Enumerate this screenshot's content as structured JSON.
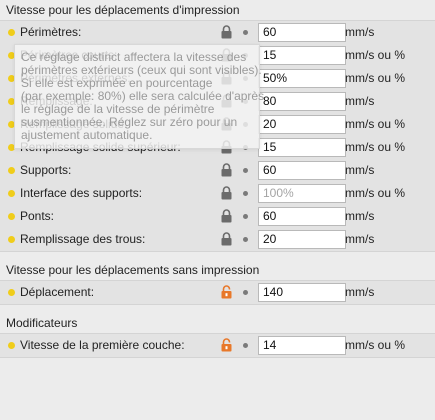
{
  "sections": [
    {
      "title": "Vitesse pour les déplacements d'impression",
      "rows": [
        {
          "label": "Périmètres:",
          "value": "60",
          "unit": "mm/s",
          "lock_color": "#6b6b6b",
          "placeholder": false
        },
        {
          "label": "Périmètres courts:",
          "value": "15",
          "unit": "mm/s ou %",
          "lock_color": "#6b6b6b",
          "placeholder": false
        },
        {
          "label": "Périmètres externes:",
          "value": "50%",
          "unit": "mm/s ou %",
          "lock_color": "#6b6b6b",
          "placeholder": false
        },
        {
          "label": "Remplissage:",
          "value": "80",
          "unit": "mm/s",
          "lock_color": "#6b6b6b",
          "placeholder": false
        },
        {
          "label": "Remplissage solide:",
          "value": "20",
          "unit": "mm/s ou %",
          "lock_color": "#6b6b6b",
          "placeholder": false
        },
        {
          "label": "Remplissage solide supérieur:",
          "value": "15",
          "unit": "mm/s ou %",
          "lock_color": "#6b6b6b",
          "placeholder": false
        },
        {
          "label": "Supports:",
          "value": "60",
          "unit": "mm/s",
          "lock_color": "#6b6b6b",
          "placeholder": false
        },
        {
          "label": "Interface des supports:",
          "value": "100%",
          "unit": "mm/s ou %",
          "lock_color": "#6b6b6b",
          "placeholder": true
        },
        {
          "label": "Ponts:",
          "value": "60",
          "unit": "mm/s",
          "lock_color": "#6b6b6b",
          "placeholder": false
        },
        {
          "label": "Remplissage des trous:",
          "value": "20",
          "unit": "mm/s",
          "lock_color": "#6b6b6b",
          "placeholder": false
        }
      ]
    },
    {
      "title": "Vitesse pour les déplacements sans impression",
      "rows": [
        {
          "label": "Déplacement:",
          "value": "140",
          "unit": "mm/s",
          "lock_color": "#e8782a",
          "placeholder": false
        }
      ]
    },
    {
      "title": "Modificateurs",
      "rows": [
        {
          "label": "Vitesse de la première couche:",
          "value": "14",
          "unit": "mm/s ou %",
          "lock_color": "#e8782a",
          "placeholder": false
        }
      ]
    }
  ],
  "tooltip": {
    "lines": [
      "Ce réglage distinct affectera la vitesse des",
      "périmètres extérieurs (ceux qui sont visibles).",
      "Si elle est exprimée en pourcentage",
      "(par exemple: 80%) elle sera calculée d'après",
      "le réglage de la vitesse de périmètre",
      "susmentionnée. Réglez sur zéro pour un",
      "ajustement automatique."
    ]
  },
  "colors": {
    "dot": "#f0cd1a",
    "lock_locked": "#6b6b6b",
    "lock_unlocked": "#e8782a"
  }
}
